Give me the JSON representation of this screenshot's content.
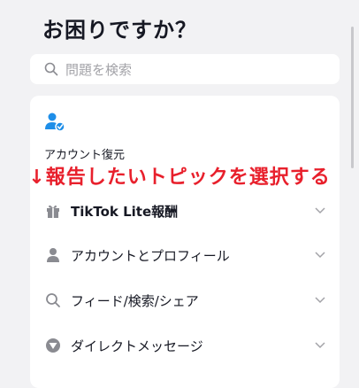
{
  "page": {
    "title": "お困りですか？"
  },
  "search": {
    "placeholder": "問題を検索"
  },
  "account": {
    "label": "アカウント復元"
  },
  "banner": {
    "text": "↓報告したいトピックを選択する"
  },
  "topics": [
    {
      "label": "TikTok Lite報酬",
      "icon": "gift-icon"
    },
    {
      "label": "アカウントとプロフィール",
      "icon": "person-icon"
    },
    {
      "label": "フィード/検索/シェア",
      "icon": "search-icon"
    },
    {
      "label": "ダイレクトメッセージ",
      "icon": "message-icon"
    }
  ],
  "colors": {
    "accent": "#1e8ee8",
    "banner": "#e8202c"
  }
}
